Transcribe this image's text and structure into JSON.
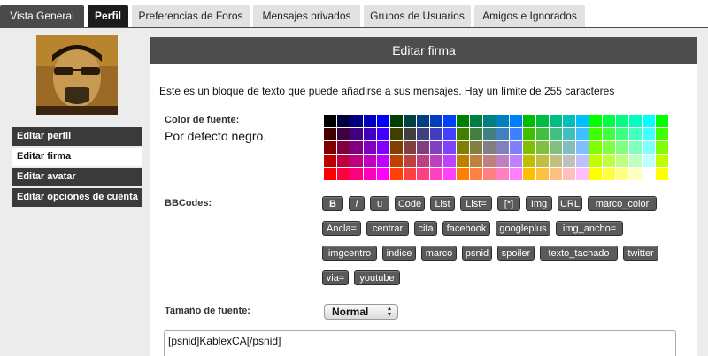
{
  "tabs": [
    {
      "label": "Vista General",
      "style": "dark"
    },
    {
      "label": "Perfil",
      "style": "black"
    },
    {
      "label": "Preferencias de Foros",
      "style": "light"
    },
    {
      "label": "Mensajes privados",
      "style": "light"
    },
    {
      "label": "Grupos de Usuarios",
      "style": "light"
    },
    {
      "label": "Amigos e Ignorados",
      "style": "light"
    }
  ],
  "sidebar": {
    "items": [
      {
        "label": "Editar perfil"
      },
      {
        "label": "Editar firma"
      },
      {
        "label": "Editar avatar"
      },
      {
        "label": "Editar opciones de cuenta"
      }
    ]
  },
  "panel": {
    "title": "Editar firma",
    "intro": "Este es un bloque de texto que puede añadirse a sus mensajes. Hay un límite de 255 caracteres",
    "color_label": "Color de fuente:",
    "color_default": "Por defecto negro.",
    "bbcodes_label": "BBCodes:",
    "bbcodes_rows": [
      [
        "B",
        "i",
        "u",
        "Code",
        "List",
        "List=",
        "[*]",
        "Img",
        "URL",
        "marco_color"
      ],
      [
        "Ancla=",
        "centrar",
        "cita",
        "facebook",
        "googleplus",
        "img_ancho="
      ],
      [
        "imgcentro",
        "indice",
        "marco",
        "psnid",
        "spoiler",
        "texto_tachado",
        "twitter"
      ],
      [
        "via=",
        "youtube"
      ]
    ],
    "font_size_label": "Tamaño de fuente:",
    "font_size_value": "Normal",
    "signature_text": "[psnid]KablexCA[/psnid]"
  },
  "colors": {
    "tab_dark": "#4a4a4a",
    "tab_active": "#1c1c1c",
    "header": "#4d4d4d",
    "bbcode_button": "#5a5a5a"
  }
}
